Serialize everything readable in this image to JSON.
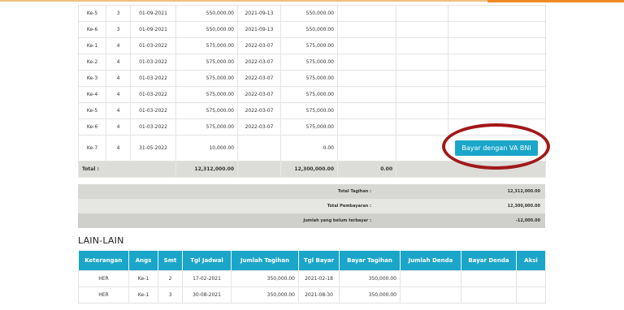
{
  "payments": {
    "rows": [
      {
        "ke": "Ke-5",
        "smt": "3",
        "tgl": "01-09-2021",
        "tagihan": "550,000.00",
        "tgl_bayar": "2021-09-13",
        "bayar": "550,000.00",
        "denda": "",
        "extra": ""
      },
      {
        "ke": "Ke-6",
        "smt": "3",
        "tgl": "01-09-2021",
        "tagihan": "550,000.00",
        "tgl_bayar": "2021-09-13",
        "bayar": "550,000.00",
        "denda": "",
        "extra": ""
      },
      {
        "ke": "Ke-1",
        "smt": "4",
        "tgl": "01-03-2022",
        "tagihan": "575,000.00",
        "tgl_bayar": "2022-03-07",
        "bayar": "575,000.00",
        "denda": "",
        "extra": ""
      },
      {
        "ke": "Ke-2",
        "smt": "4",
        "tgl": "01-03-2022",
        "tagihan": "575,000.00",
        "tgl_bayar": "2022-03-07",
        "bayar": "575,000.00",
        "denda": "",
        "extra": ""
      },
      {
        "ke": "Ke-3",
        "smt": "4",
        "tgl": "01-03-2022",
        "tagihan": "575,000.00",
        "tgl_bayar": "2022-03-07",
        "bayar": "575,000.00",
        "denda": "",
        "extra": ""
      },
      {
        "ke": "Ke-4",
        "smt": "4",
        "tgl": "01-03-2022",
        "tagihan": "575,000.00",
        "tgl_bayar": "2022-03-07",
        "bayar": "575,000.00",
        "denda": "",
        "extra": ""
      },
      {
        "ke": "Ke-5",
        "smt": "4",
        "tgl": "01-03-2022",
        "tagihan": "575,000.00",
        "tgl_bayar": "2022-03-07",
        "bayar": "575,000.00",
        "denda": "",
        "extra": ""
      },
      {
        "ke": "Ke-6",
        "smt": "4",
        "tgl": "01-03-2022",
        "tagihan": "575,000.00",
        "tgl_bayar": "2022-03-07",
        "bayar": "575,000.00",
        "denda": "",
        "extra": ""
      },
      {
        "ke": "Ke-7",
        "smt": "4",
        "tgl": "31-05-2022",
        "tagihan": "10,000.00",
        "tgl_bayar": "",
        "bayar": "0.00",
        "denda": "",
        "extra": ""
      }
    ],
    "pay_button": "Bayar dengan VA BNI",
    "total": {
      "label": "Total :",
      "tagihan": "12,312,000.00",
      "bayar": "12,300,000.00",
      "denda": "0.00"
    }
  },
  "summary": {
    "total_tagihan_label": "Total Tagihan :",
    "total_tagihan": "12,312,000.00",
    "total_pembayaran_label": "Total Pembayaran :",
    "total_pembayaran": "12,300,000.00",
    "belum_label": "Jumlah yang belum terbayar :",
    "belum": "-12,000.00"
  },
  "lain": {
    "title": "LAIN-LAIN",
    "headers": [
      "Keterangan",
      "Angs",
      "Smt",
      "Tgl Jadwal",
      "Jumlah Tagihan",
      "Tgl Bayar",
      "Bayar Tagihan",
      "Jumlah Denda",
      "Bayar Denda",
      "Aksi"
    ],
    "rows": [
      {
        "ket": "HER",
        "angs": "Ke-1",
        "smt": "2",
        "jadwal": "17-02-2021",
        "tagihan": "350,000.00",
        "tgl_bayar": "2021-02-18",
        "bayar": "350,000.00"
      },
      {
        "ket": "HER",
        "angs": "Ke-1",
        "smt": "3",
        "jadwal": "30-08-2021",
        "tagihan": "350,000.00",
        "tgl_bayar": "2021-08-30",
        "bayar": "350,000.00"
      }
    ]
  },
  "colors": {
    "accent": "#1ba6c9",
    "highlight": "#a11818"
  }
}
